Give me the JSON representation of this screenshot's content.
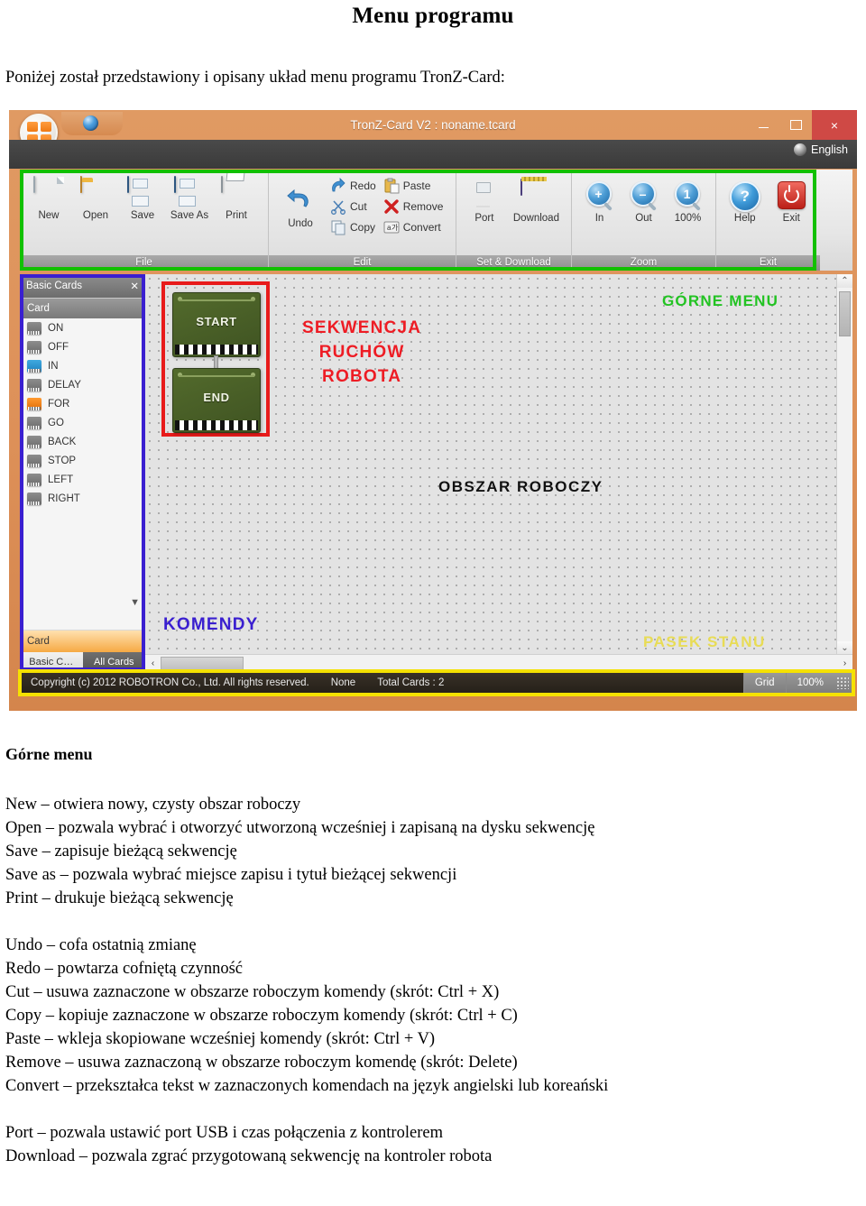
{
  "document": {
    "title": "Menu programu",
    "intro": "Poniżej został przedstawiony i opisany układ menu programu TronZ-Card:",
    "section_heading": "Górne menu",
    "paragraphs": [
      "New – otwiera nowy, czysty obszar roboczy",
      "Open – pozwala wybrać i otworzyć utworzoną wcześniej i zapisaną na dysku sekwencję",
      "Save – zapisuje bieżącą sekwencję",
      "Save as – pozwala wybrać miejsce zapisu i tytuł bieżącej sekwencji",
      "Print – drukuje bieżącą sekwencję",
      "Undo – cofa ostatnią zmianę",
      "Redo – powtarza cofniętą czynność",
      "Cut – usuwa zaznaczone w obszarze roboczym komendy (skrót: Ctrl + X)",
      "Copy – kopiuje zaznaczone w obszarze roboczym komendy (skrót: Ctrl + C)",
      "Paste – wkleja skopiowane wcześniej komendy (skrót: Ctrl + V)",
      "Remove – usuwa zaznaczoną w obszarze roboczym komendę (skrót: Delete)",
      "Convert – przekształca tekst w zaznaczonych komendach na język angielski lub koreański",
      "Port – pozwala ustawić port USB i czas połączenia z kontrolerem",
      "Download – pozwala zgrać przygotowaną sekwencję na kontroler robota"
    ]
  },
  "app": {
    "window_title": "TronZ-Card V2 : noname.tcard",
    "language": "English",
    "window_buttons": {
      "minimize": "–",
      "maximize": "□",
      "close": "×"
    },
    "ribbon_groups": [
      {
        "name": "File",
        "big_buttons": [
          {
            "label": "New",
            "icon": "new-document-icon"
          },
          {
            "label": "Open",
            "icon": "open-folder-icon"
          },
          {
            "label": "Save",
            "icon": "floppy-disk-icon"
          },
          {
            "label": "Save As",
            "icon": "floppy-disk-icon"
          },
          {
            "label": "Print",
            "icon": "printer-icon"
          }
        ],
        "small_buttons": []
      },
      {
        "name": "Edit",
        "big_buttons": [
          {
            "label": "Undo",
            "icon": "undo-arrow-icon"
          }
        ],
        "small_buttons": [
          {
            "label": "Redo",
            "icon": "redo-arrow-icon"
          },
          {
            "label": "Cut",
            "icon": "scissors-icon"
          },
          {
            "label": "Copy",
            "icon": "copy-pages-icon"
          },
          {
            "label": "Paste",
            "icon": "clipboard-paste-icon"
          },
          {
            "label": "Remove",
            "icon": "red-x-icon"
          },
          {
            "label": "Convert",
            "icon": "translate-icon"
          }
        ]
      },
      {
        "name": "Set & Download",
        "big_buttons": [
          {
            "label": "Port",
            "icon": "usb-port-icon"
          },
          {
            "label": "Download",
            "icon": "controller-chip-icon"
          }
        ],
        "small_buttons": []
      },
      {
        "name": "Zoom",
        "big_buttons": [
          {
            "label": "In",
            "icon": "zoom-in-icon",
            "glyph": "+"
          },
          {
            "label": "Out",
            "icon": "zoom-out-icon",
            "glyph": "–"
          },
          {
            "label": "100%",
            "icon": "zoom-reset-icon",
            "glyph": "1"
          }
        ],
        "small_buttons": []
      },
      {
        "name": "Exit",
        "big_buttons": [
          {
            "label": "Help",
            "icon": "help-question-icon"
          },
          {
            "label": "Exit",
            "icon": "power-off-icon"
          }
        ],
        "small_buttons": []
      }
    ],
    "card_panel": {
      "title": "Basic Cards",
      "close_glyph": "✕",
      "column_header": "Card",
      "items": [
        {
          "label": "ON",
          "color": "gray"
        },
        {
          "label": "OFF",
          "color": "gray"
        },
        {
          "label": "IN",
          "color": "blue"
        },
        {
          "label": "DELAY",
          "color": "gray"
        },
        {
          "label": "FOR",
          "color": "orange"
        },
        {
          "label": "GO",
          "color": "gray"
        },
        {
          "label": "BACK",
          "color": "gray"
        },
        {
          "label": "STOP",
          "color": "gray"
        },
        {
          "label": "LEFT",
          "color": "gray"
        },
        {
          "label": "RIGHT",
          "color": "gray"
        }
      ],
      "more_glyph": "▼",
      "footer_label": "Card",
      "tabs": [
        {
          "label": "Basic C…",
          "active": true
        },
        {
          "label": "All Cards",
          "active": false
        }
      ]
    },
    "workspace": {
      "nodes": [
        {
          "label": "START"
        },
        {
          "label": "END"
        }
      ],
      "annotations": [
        {
          "text": "SEKWENCJA\nRUCHÓW\nROBOTA",
          "color": "red"
        },
        {
          "text": "GÓRNE MENU",
          "color": "green"
        },
        {
          "text": "OBSZAR ROBOCZY",
          "color": "black"
        },
        {
          "text": "KOMENDY",
          "color": "blue"
        },
        {
          "text": "PASEK STANU",
          "color": "yellow"
        }
      ],
      "scroll": {
        "up": "⌃",
        "down": "⌄",
        "left": "‹",
        "right": "›"
      }
    },
    "status_bar": {
      "copyright": "Copyright (c) 2012 ROBOTRON Co., Ltd.  All rights reserved.",
      "selection": "None",
      "total_cards": "Total Cards : 2",
      "grid": "Grid",
      "zoom": "100%"
    },
    "highlight_colors": {
      "top_menu": "#12c000",
      "commands": "#3a1fd0",
      "sequence": "#e81b1b",
      "status_bar": "#f5e100"
    }
  }
}
